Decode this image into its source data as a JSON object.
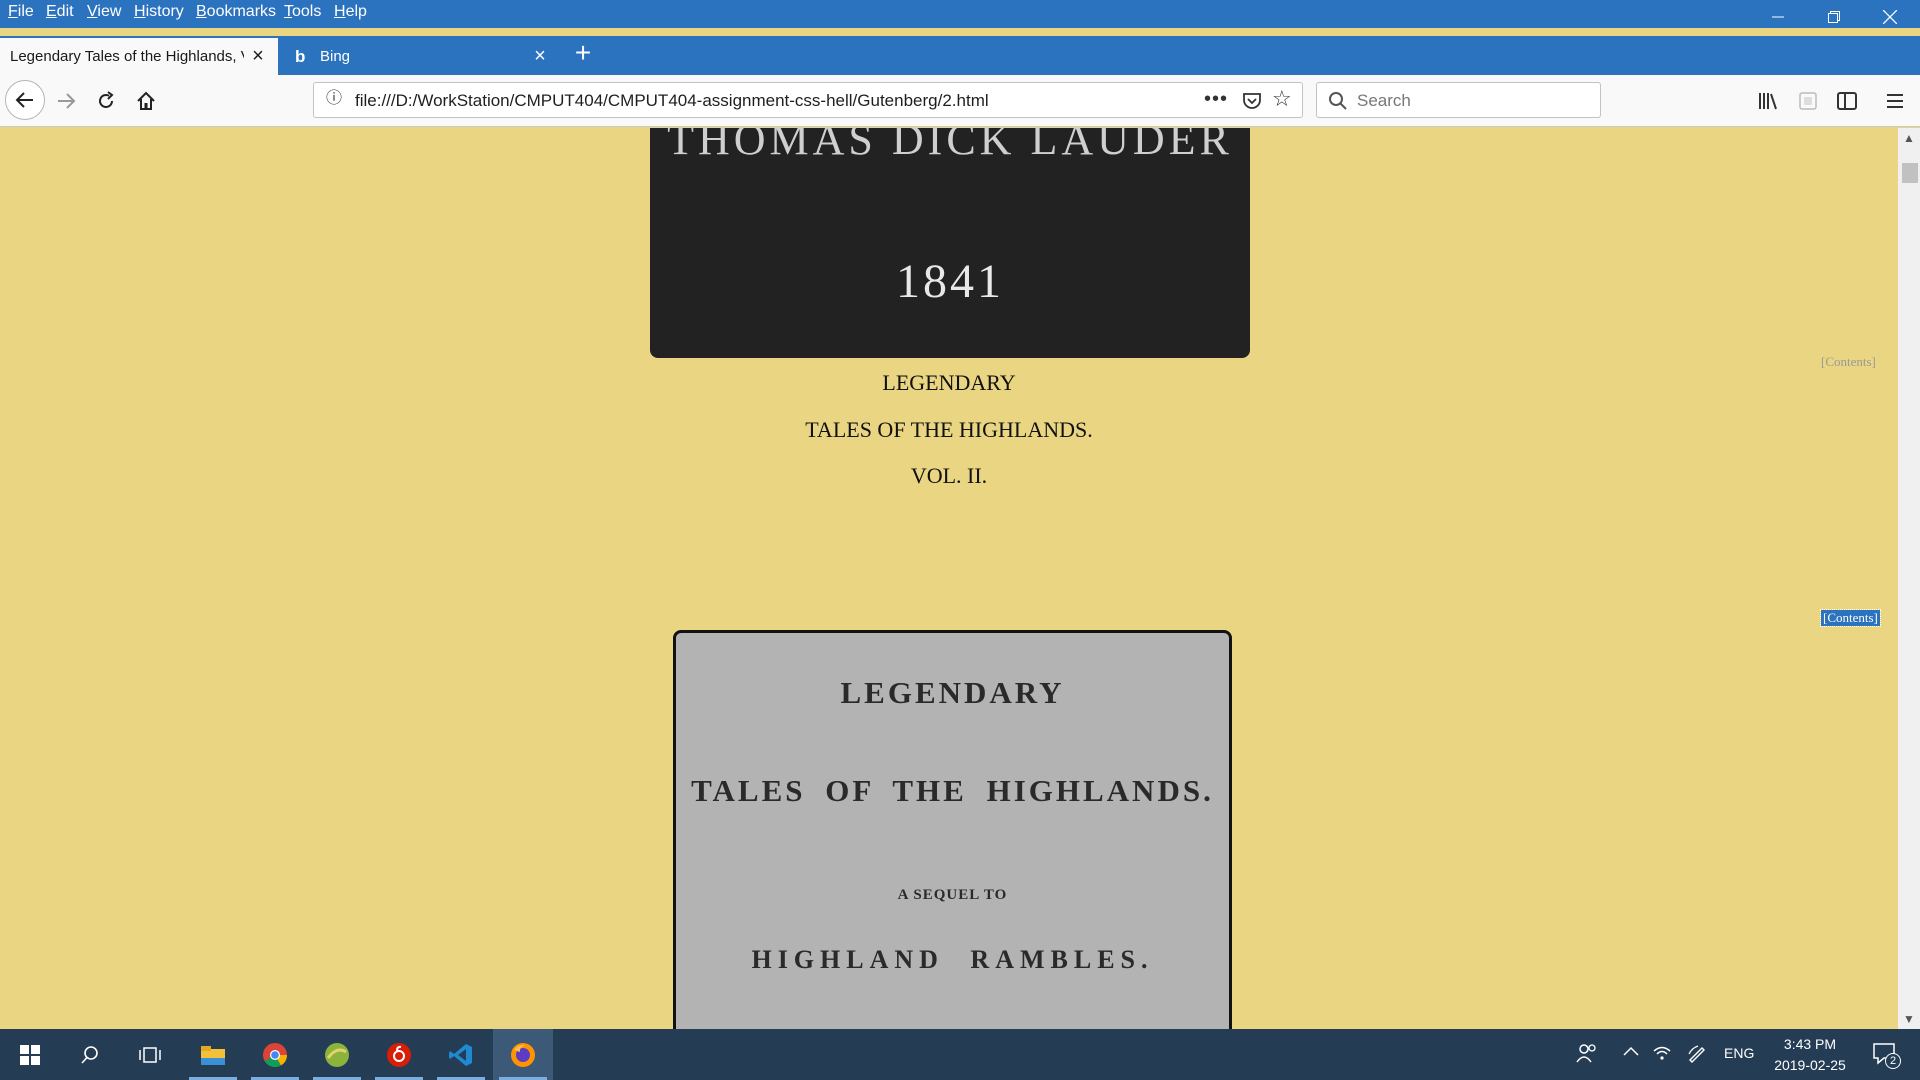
{
  "menu": [
    "File",
    "Edit",
    "View",
    "History",
    "Bookmarks",
    "Tools",
    "Help"
  ],
  "tabs": [
    {
      "title": "Legendary Tales of the Highlands, V"
    },
    {
      "title": "Bing"
    }
  ],
  "address": {
    "url": "file:///D:/WorkStation/CMPUT404/CMPUT404-assignment-css-hell/Gutenberg/2.html"
  },
  "search": {
    "placeholder": "Search"
  },
  "page": {
    "cover_partial_text": "THOMAS DICK LAUDER",
    "cover_year": "1841",
    "contents_link": "[Contents]",
    "heading_lines": [
      "LEGENDARY",
      "TALES OF THE HIGHLANDS.",
      "VOL. II."
    ],
    "title_page_lines": [
      "LEGENDARY",
      "TALES OF THE HIGHLANDS.",
      "A SEQUEL TO",
      "HIGHLAND RAMBLES."
    ]
  },
  "taskbar": {
    "apps": [
      "start",
      "search",
      "task-view",
      "file-explorer",
      "chrome",
      "app-green",
      "netease-music",
      "vscode",
      "firefox"
    ],
    "language": "ENG",
    "time": "3:43 PM",
    "date": "2019-02-25",
    "notification_count": "2"
  },
  "colors": {
    "chrome_blue": "#2b72bf",
    "page_background": "#e9d582",
    "taskbar": "#243d55"
  }
}
